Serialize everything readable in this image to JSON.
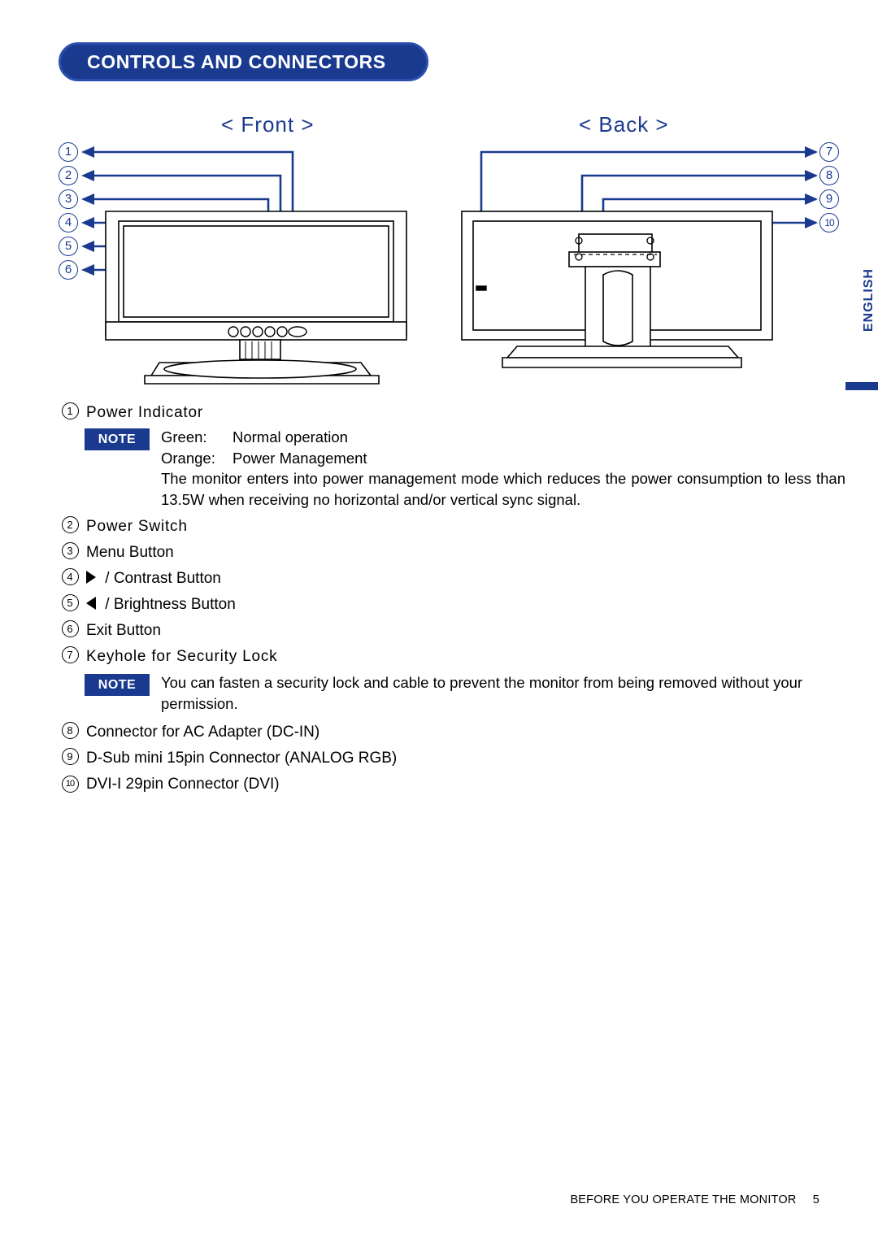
{
  "header": {
    "title": "CONTROLS AND CONNECTORS"
  },
  "side_tab": {
    "label": "ENGLISH"
  },
  "figure": {
    "front_label": "< Front >",
    "back_label": "< Back >",
    "front_callouts": [
      "1",
      "2",
      "3",
      "4",
      "5",
      "6"
    ],
    "back_callouts": [
      "7",
      "8",
      "9",
      "10"
    ]
  },
  "items": [
    {
      "num": "1",
      "text": "Power Indicator"
    },
    {
      "num": "2",
      "text": "Power Switch"
    },
    {
      "num": "3",
      "text": "Menu Button"
    },
    {
      "num": "4",
      "text": "/ Contrast Button",
      "icon": "triangle-right-icon"
    },
    {
      "num": "5",
      "text": "/ Brightness Button",
      "icon": "triangle-left-icon"
    },
    {
      "num": "6",
      "text": "Exit Button"
    },
    {
      "num": "7",
      "text": "Keyhole for Security Lock"
    },
    {
      "num": "8",
      "text": "Connector for AC Adapter (DC-IN)"
    },
    {
      "num": "9",
      "text": "D-Sub mini 15pin Connector (ANALOG RGB)"
    },
    {
      "num": "10",
      "text": "DVI-I 29pin Connector (DVI)"
    }
  ],
  "note1": {
    "badge": "NOTE",
    "green_key": "Green:",
    "green_val": "Normal operation",
    "orange_key": "Orange:",
    "orange_val": "Power Management",
    "paragraph": "The monitor enters into power management mode which reduces the power consumption to less than 13.5W when receiving no horizontal and/or vertical sync signal."
  },
  "note2": {
    "badge": "NOTE",
    "paragraph": "You can fasten a security lock and cable to prevent the monitor from being removed without your permission."
  },
  "footer": {
    "text": "BEFORE YOU OPERATE THE MONITOR",
    "page": "5"
  },
  "colors": {
    "accent": "#1a3a8f",
    "accent_light": "#2a4faf"
  }
}
